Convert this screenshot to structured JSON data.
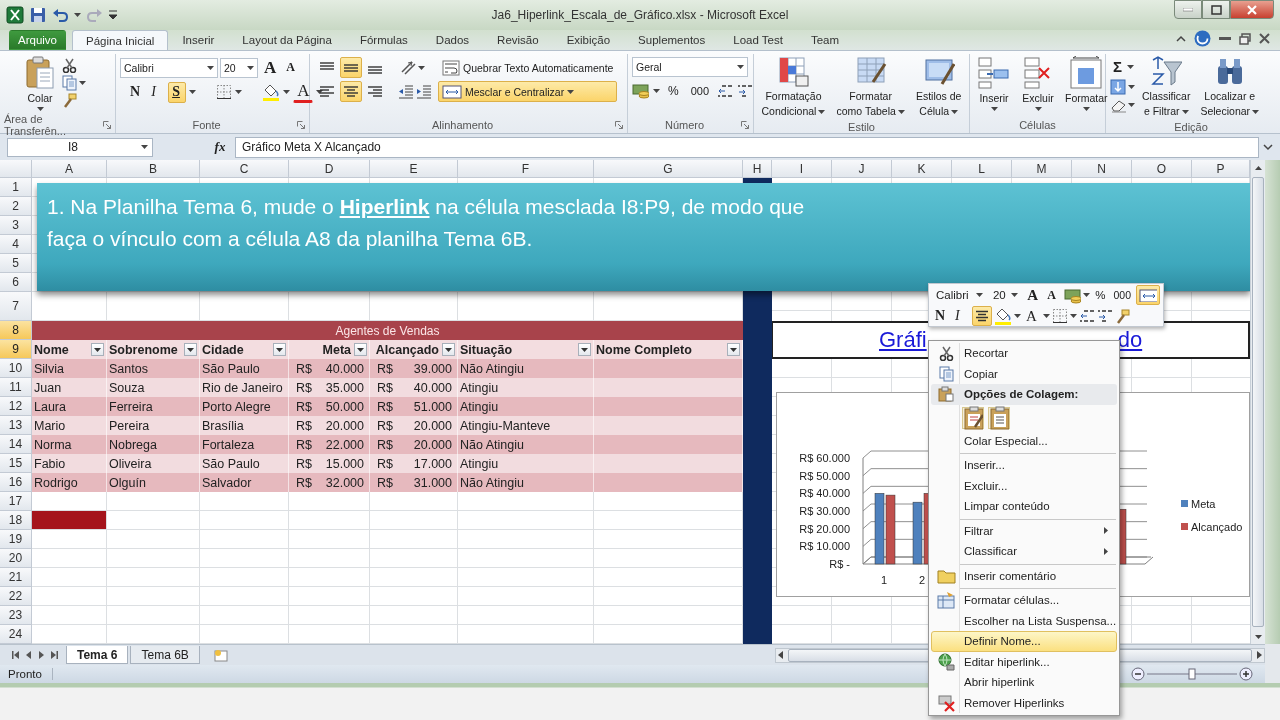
{
  "window": {
    "title": "Ja6_Hiperlink_Escala_de_Gráfico.xlsx - Microsoft Excel"
  },
  "menu_tabs": [
    {
      "label": "Arquivo",
      "kind": "file",
      "selected": false
    },
    {
      "label": "Página Inicial",
      "kind": "tab",
      "selected": true
    },
    {
      "label": "Inserir",
      "kind": "tab",
      "selected": false
    },
    {
      "label": "Layout da Página",
      "kind": "tab",
      "selected": false
    },
    {
      "label": "Fórmulas",
      "kind": "tab",
      "selected": false
    },
    {
      "label": "Dados",
      "kind": "tab",
      "selected": false
    },
    {
      "label": "Revisão",
      "kind": "tab",
      "selected": false
    },
    {
      "label": "Exibição",
      "kind": "tab",
      "selected": false
    },
    {
      "label": "Suplementos",
      "kind": "tab",
      "selected": false
    },
    {
      "label": "Load Test",
      "kind": "tab",
      "selected": false
    },
    {
      "label": "Team",
      "kind": "tab",
      "selected": false
    }
  ],
  "ribbon": {
    "clipboard": {
      "label": "Área de Transferên...",
      "paste": "Colar"
    },
    "font": {
      "label": "Fonte",
      "family": "Calibri",
      "size": "20",
      "grow": "A",
      "shrink": "A",
      "bold": {
        "label": "N",
        "selected": false
      },
      "italic": {
        "label": "I",
        "selected": false
      },
      "underline": {
        "label": "S",
        "selected": true
      },
      "font_color": "A"
    },
    "alignment": {
      "label": "Alinhamento",
      "vertical": [
        {
          "selected": false
        },
        {
          "selected": true
        },
        {
          "selected": false
        }
      ],
      "horizontal": [
        {
          "selected": false
        },
        {
          "selected": true
        },
        {
          "selected": false
        }
      ],
      "wrap": {
        "label": "Quebrar Texto Automaticamente",
        "selected": false
      },
      "merge": {
        "label": "Mesclar e Centralizar",
        "selected": true
      }
    },
    "number": {
      "label": "Número",
      "format": "Geral",
      "percent": "%",
      "thousands": "000"
    },
    "styles": {
      "label": "Estilo",
      "buttons": [
        {
          "lines": [
            "Formatação",
            "Condicional"
          ]
        },
        {
          "lines": [
            "Formatar",
            "como Tabela"
          ]
        },
        {
          "lines": [
            "Estilos de",
            "Célula"
          ]
        }
      ]
    },
    "cells": {
      "label": "Células",
      "buttons": [
        "Inserir",
        "Excluir",
        "Formatar"
      ]
    },
    "editing": {
      "label": "Edição",
      "sum": "Σ",
      "buttons": [
        {
          "lines": [
            "Classificar",
            "e Filtrar"
          ]
        },
        {
          "lines": [
            "Localizar e",
            "Selecionar"
          ]
        }
      ]
    }
  },
  "formula_bar": {
    "name_box": "I8",
    "function_label": "fx",
    "formula": "Gráfico Meta X Alcançado"
  },
  "columns": [
    "A",
    "B",
    "C",
    "D",
    "E",
    "F",
    "G",
    "H",
    "I",
    "J",
    "K",
    "L",
    "M",
    "N",
    "O",
    "P"
  ],
  "rows": [
    {
      "label": "1",
      "selected": false,
      "filled": false
    },
    {
      "label": "2",
      "selected": false,
      "filled": false
    },
    {
      "label": "3",
      "selected": false,
      "filled": false
    },
    {
      "label": "4",
      "selected": false,
      "filled": false
    },
    {
      "label": "5",
      "selected": false,
      "filled": false
    },
    {
      "label": "6",
      "selected": false,
      "filled": false
    },
    {
      "label": "7",
      "selected": false,
      "filled": false
    },
    {
      "label": "8",
      "selected": true,
      "filled": false
    },
    {
      "label": "9",
      "selected": true,
      "filled": false
    },
    {
      "label": "10",
      "selected": false,
      "filled": false
    },
    {
      "label": "11",
      "selected": false,
      "filled": false
    },
    {
      "label": "12",
      "selected": false,
      "filled": false
    },
    {
      "label": "13",
      "selected": false,
      "filled": false
    },
    {
      "label": "14",
      "selected": false,
      "filled": false
    },
    {
      "label": "15",
      "selected": false,
      "filled": false
    },
    {
      "label": "16",
      "selected": false,
      "filled": false
    },
    {
      "label": "17",
      "selected": false,
      "filled": false
    },
    {
      "label": "18",
      "selected": false,
      "filled": true
    },
    {
      "label": "19",
      "selected": false,
      "filled": false
    },
    {
      "label": "20",
      "selected": false,
      "filled": false
    },
    {
      "label": "21",
      "selected": false,
      "filled": false
    },
    {
      "label": "22",
      "selected": false,
      "filled": false
    },
    {
      "label": "23",
      "selected": false,
      "filled": false
    },
    {
      "label": "24",
      "selected": false,
      "filled": false
    }
  ],
  "banner": {
    "text": "1. Na Planilha Tema 6, mude o **Hiperlink** na célula mesclada I8:P9, de modo que faça o vínculo com a célula A8 da planilha Tema 6B."
  },
  "table": {
    "title": "Agentes de Vendas",
    "columns": [
      {
        "label": "Nome",
        "kind": "text"
      },
      {
        "label": "Sobrenome",
        "kind": "text"
      },
      {
        "label": "Cidade",
        "kind": "text"
      },
      {
        "label": "Meta",
        "kind": "currency"
      },
      {
        "label": "Alcançado",
        "kind": "currency"
      },
      {
        "label": "Situação",
        "kind": "text"
      },
      {
        "label": "Nome Completo",
        "kind": "text"
      }
    ],
    "rows": [
      [
        "Silvia",
        "Santos",
        "São Paulo",
        {
          "symbol": "R$",
          "amount": "40.000"
        },
        {
          "symbol": "R$",
          "amount": "39.000"
        },
        "Não Atingiu"
      ],
      [
        "Juan",
        "Souza",
        "Rio de Janeiro",
        {
          "symbol": "R$",
          "amount": "35.000"
        },
        {
          "symbol": "R$",
          "amount": "40.000"
        },
        "Atingiu"
      ],
      [
        "Laura",
        "Ferreira",
        "Porto Alegre",
        {
          "symbol": "R$",
          "amount": "50.000"
        },
        {
          "symbol": "R$",
          "amount": "51.000"
        },
        "Atingiu"
      ],
      [
        "Mario",
        "Pereira",
        "Brasília",
        {
          "symbol": "R$",
          "amount": "20.000"
        },
        {
          "symbol": "R$",
          "amount": "20.000"
        },
        "Atingiu-Manteve"
      ],
      [
        "Norma",
        "Nobrega",
        "Fortaleza",
        {
          "symbol": "R$",
          "amount": "22.000"
        },
        {
          "symbol": "R$",
          "amount": "20.000"
        },
        "Não Atingiu"
      ],
      [
        "Fabio",
        "Oliveira",
        "São Paulo",
        {
          "symbol": "R$",
          "amount": "15.000"
        },
        {
          "symbol": "R$",
          "amount": "17.000"
        },
        "Atingiu"
      ],
      [
        "Rodrigo",
        "Olguín",
        "Salvador",
        {
          "symbol": "R$",
          "amount": "32.000"
        },
        {
          "symbol": "R$",
          "amount": "31.000"
        },
        "Não Atingiu"
      ]
    ]
  },
  "linked_cell": {
    "visible_parts": [
      "Gráfi",
      "do"
    ]
  },
  "chart": {
    "y_axis_labels": [
      "R$ 60.000",
      "R$ 50.000",
      "R$ 40.000",
      "R$ 30.000",
      "R$ 20.000",
      "R$ 10.000",
      "R$ -"
    ],
    "x_axis_labels": [
      "1",
      "2"
    ],
    "legend": [
      {
        "name": "Meta",
        "color": "#4f81bd"
      },
      {
        "name": "Alcançado",
        "color": "#c0504d"
      }
    ]
  },
  "mini_toolbar": {
    "font": "Calibri",
    "size": "20",
    "grow": "A",
    "shrink": "A",
    "percent": "%",
    "thousands": "000",
    "merge": {
      "selected": true
    },
    "bold": "N",
    "italic": "I",
    "center": {
      "selected": true
    },
    "font_color": "A"
  },
  "context_menu": {
    "items": [
      {
        "kind": "command",
        "label": "Recortar",
        "selected": false,
        "submenu": false,
        "separator_before": false
      },
      {
        "kind": "command",
        "label": "Copiar",
        "selected": false,
        "submenu": false,
        "separator_before": false
      },
      {
        "kind": "header",
        "label": "Opções de Colagem:",
        "selected": false,
        "submenu": false,
        "separator_before": false
      },
      {
        "kind": "paste_options"
      },
      {
        "kind": "command",
        "label": "Colar Especial...",
        "selected": false,
        "submenu": false,
        "separator_before": false
      },
      {
        "kind": "command",
        "label": "Inserir...",
        "selected": false,
        "submenu": false,
        "separator_before": true
      },
      {
        "kind": "command",
        "label": "Excluir...",
        "selected": false,
        "submenu": false,
        "separator_before": false
      },
      {
        "kind": "command",
        "label": "Limpar conteúdo",
        "selected": false,
        "submenu": false,
        "separator_before": false
      },
      {
        "kind": "command",
        "label": "Filtrar",
        "selected": false,
        "submenu": true,
        "separator_before": true
      },
      {
        "kind": "command",
        "label": "Classificar",
        "selected": false,
        "submenu": true,
        "separator_before": false
      },
      {
        "kind": "command",
        "label": "Inserir comentário",
        "selected": false,
        "submenu": false,
        "separator_before": true
      },
      {
        "kind": "command",
        "label": "Formatar células...",
        "selected": false,
        "submenu": false,
        "separator_before": true
      },
      {
        "kind": "command",
        "label": "Escolher na Lista Suspensa...",
        "selected": false,
        "submenu": false,
        "separator_before": false
      },
      {
        "kind": "command",
        "label": "Definir Nome...",
        "selected": true,
        "submenu": false,
        "separator_before": false
      },
      {
        "kind": "command",
        "label": "Editar hiperlink...",
        "selected": false,
        "submenu": false,
        "separator_before": false
      },
      {
        "kind": "command",
        "label": "Abrir hiperlink",
        "selected": false,
        "submenu": false,
        "separator_before": false
      },
      {
        "kind": "command",
        "label": "Remover Hiperlinks",
        "selected": false,
        "submenu": false,
        "separator_before": false
      }
    ]
  },
  "sheet_tabs": [
    {
      "label": "Tema 6",
      "selected": true
    },
    {
      "label": "Tema 6B",
      "selected": false
    }
  ],
  "status_bar": {
    "text": "Pronto",
    "zoom": {
      "level": 0.5
    }
  }
}
